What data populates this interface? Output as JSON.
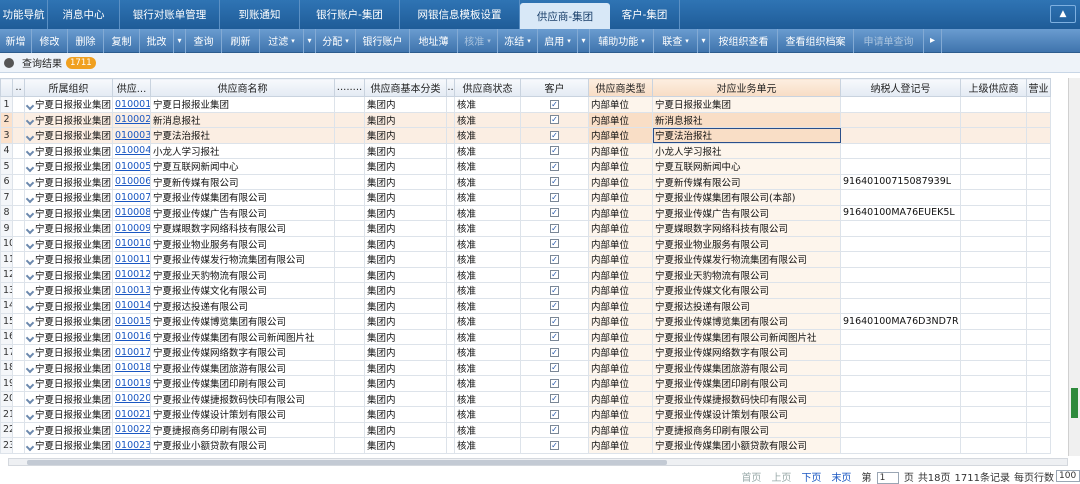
{
  "tabs": [
    {
      "label": "功能导航",
      "active": false,
      "w": 48
    },
    {
      "label": "消息中心",
      "active": false,
      "w": 72
    },
    {
      "label": "银行对账单管理",
      "active": false,
      "w": 100
    },
    {
      "label": "到账通知",
      "active": false,
      "w": 80
    },
    {
      "label": "银行账户-集团",
      "active": false,
      "w": 100
    },
    {
      "label": "网银信息模板设置",
      "active": false,
      "w": 120
    },
    {
      "label": "供应商-集团",
      "active": true,
      "w": 90
    },
    {
      "label": "客户-集团",
      "active": false,
      "w": 70
    }
  ],
  "tab_end_icon": "▲",
  "toolbar": [
    {
      "label": "新增",
      "w": 32
    },
    {
      "label": "修改",
      "w": 36
    },
    {
      "label": "删除",
      "w": 36
    },
    {
      "label": "复制",
      "w": 36
    },
    {
      "label": "批改",
      "w": 34
    },
    {
      "sep": true
    },
    {
      "label": "查询",
      "w": 36
    },
    {
      "label": "刷新",
      "w": 38
    },
    {
      "label": "过滤",
      "caret": true,
      "w": 44
    },
    {
      "sep": true
    },
    {
      "label": "分配",
      "caret": true,
      "w": 40
    },
    {
      "label": "银行账户",
      "w": 54
    },
    {
      "label": "地址薄",
      "w": 48
    },
    {
      "label": "核准",
      "caret": true,
      "disabled": true,
      "w": 40
    },
    {
      "label": "冻结",
      "caret": true,
      "w": 40
    },
    {
      "label": "启用",
      "caret": true,
      "w": 40
    },
    {
      "sep": true
    },
    {
      "label": "辅助功能",
      "caret": true,
      "w": 64
    },
    {
      "label": "联查",
      "caret": true,
      "w": 44
    },
    {
      "sep": true
    },
    {
      "label": "按组织查看",
      "w": 68
    },
    {
      "label": "查看组织档案",
      "w": 76
    },
    {
      "label": "申请单查询",
      "disabled": true,
      "w": 70
    },
    {
      "label": "▸",
      "w": 18
    }
  ],
  "result": {
    "label": "查询结果",
    "count": "1711"
  },
  "columns": [
    {
      "label": "",
      "w": 12
    },
    {
      "label": "..",
      "w": 12
    },
    {
      "label": "所属组织",
      "w": 88
    },
    {
      "label": "供应...",
      "w": 38
    },
    {
      "label": "供应商名称",
      "w": 184
    },
    {
      "label": "........",
      "w": 30
    },
    {
      "label": "供应商基本分类",
      "w": 82
    },
    {
      "label": "..",
      "w": 8
    },
    {
      "label": "供应商状态",
      "w": 66
    },
    {
      "label": "客户",
      "w": 68
    },
    {
      "label": "供应商类型",
      "w": 64,
      "hl": true
    },
    {
      "label": "对应业务单元",
      "w": 188,
      "hl": true
    },
    {
      "label": "纳税人登记号",
      "w": 120
    },
    {
      "label": "上级供应商",
      "w": 66
    },
    {
      "label": "营业",
      "w": 24
    }
  ],
  "rows": [
    {
      "n": "1",
      "org": "宁夏日报报业集团",
      "code": "010001",
      "name": "宁夏日报报业集团",
      "cls": "集团内",
      "status": "核准",
      "type": "内部单位",
      "unit": "宁夏日报报业集团",
      "tax": ""
    },
    {
      "n": "2",
      "org": "宁夏日报报业集团",
      "code": "010002",
      "name": "新消息报社",
      "cls": "集团内",
      "status": "核准",
      "type": "内部单位",
      "unit": "新消息报社",
      "tax": "",
      "sel": true
    },
    {
      "n": "3",
      "org": "宁夏日报报业集团",
      "code": "010003",
      "name": "宁夏法治报社",
      "cls": "集团内",
      "status": "核准",
      "type": "内部单位",
      "unit": "宁夏法治报社",
      "tax": "",
      "sel": true,
      "focus": true
    },
    {
      "n": "4",
      "org": "宁夏日报报业集团",
      "code": "010004",
      "name": "小龙人学习报社",
      "cls": "集团内",
      "status": "核准",
      "type": "内部单位",
      "unit": "小龙人学习报社",
      "tax": ""
    },
    {
      "n": "5",
      "org": "宁夏日报报业集团",
      "code": "010005",
      "name": "宁夏互联网新闻中心",
      "cls": "集团内",
      "status": "核准",
      "type": "内部单位",
      "unit": "宁夏互联网新闻中心",
      "tax": ""
    },
    {
      "n": "6",
      "org": "宁夏日报报业集团",
      "code": "010006",
      "name": "宁夏新传媒有限公司",
      "cls": "集团内",
      "status": "核准",
      "type": "内部单位",
      "unit": "宁夏新传媒有限公司",
      "tax": "91640100715087939L"
    },
    {
      "n": "7",
      "org": "宁夏日报报业集团",
      "code": "010007",
      "name": "宁夏报业传媒集团有限公司",
      "cls": "集团内",
      "status": "核准",
      "type": "内部单位",
      "unit": "宁夏报业传媒集团有限公司(本部)",
      "tax": ""
    },
    {
      "n": "8",
      "org": "宁夏日报报业集团",
      "code": "010008",
      "name": "宁夏报业传媒广告有限公司",
      "cls": "集团内",
      "status": "核准",
      "type": "内部单位",
      "unit": "宁夏报业传媒广告有限公司",
      "tax": "91640100MA76EUEK5L"
    },
    {
      "n": "9",
      "org": "宁夏日报报业集团",
      "code": "010009",
      "name": "宁夏媒眼数字网络科技有限公司",
      "cls": "集团内",
      "status": "核准",
      "type": "内部单位",
      "unit": "宁夏媒眼数字网络科技有限公司",
      "tax": ""
    },
    {
      "n": "10",
      "org": "宁夏日报报业集团",
      "code": "010010",
      "name": "宁夏报业物业服务有限公司",
      "cls": "集团内",
      "status": "核准",
      "type": "内部单位",
      "unit": "宁夏报业物业服务有限公司",
      "tax": ""
    },
    {
      "n": "11",
      "org": "宁夏日报报业集团",
      "code": "010011",
      "name": "宁夏报业传媒发行物流集团有限公司",
      "cls": "集团内",
      "status": "核准",
      "type": "内部单位",
      "unit": "宁夏报业传媒发行物流集团有限公司",
      "tax": ""
    },
    {
      "n": "12",
      "org": "宁夏日报报业集团",
      "code": "010012",
      "name": "宁夏报业天豹物流有限公司",
      "cls": "集团内",
      "status": "核准",
      "type": "内部单位",
      "unit": "宁夏报业天豹物流有限公司",
      "tax": ""
    },
    {
      "n": "13",
      "org": "宁夏日报报业集团",
      "code": "010013",
      "name": "宁夏报业传媒文化有限公司",
      "cls": "集团内",
      "status": "核准",
      "type": "内部单位",
      "unit": "宁夏报业传媒文化有限公司",
      "tax": ""
    },
    {
      "n": "14",
      "org": "宁夏日报报业集团",
      "code": "010014",
      "name": "宁夏报达投递有限公司",
      "cls": "集团内",
      "status": "核准",
      "type": "内部单位",
      "unit": "宁夏报达投递有限公司",
      "tax": ""
    },
    {
      "n": "15",
      "org": "宁夏日报报业集团",
      "code": "010015",
      "name": "宁夏报业传媒博览集团有限公司",
      "cls": "集团内",
      "status": "核准",
      "type": "内部单位",
      "unit": "宁夏报业传媒博览集团有限公司",
      "tax": "91640100MA76D3ND7R"
    },
    {
      "n": "16",
      "org": "宁夏日报报业集团",
      "code": "010016",
      "name": "宁夏报业传媒集团有限公司新闻图片社",
      "cls": "集团内",
      "status": "核准",
      "type": "内部单位",
      "unit": "宁夏报业传媒集团有限公司新闻图片社",
      "tax": ""
    },
    {
      "n": "17",
      "org": "宁夏日报报业集团",
      "code": "010017",
      "name": "宁夏报业传媒网络数字有限公司",
      "cls": "集团内",
      "status": "核准",
      "type": "内部单位",
      "unit": "宁夏报业传媒网络数字有限公司",
      "tax": ""
    },
    {
      "n": "18",
      "org": "宁夏日报报业集团",
      "code": "010018",
      "name": "宁夏报业传媒集团旅游有限公司",
      "cls": "集团内",
      "status": "核准",
      "type": "内部单位",
      "unit": "宁夏报业传媒集团旅游有限公司",
      "tax": ""
    },
    {
      "n": "19",
      "org": "宁夏日报报业集团",
      "code": "010019",
      "name": "宁夏报业传媒集团印刷有限公司",
      "cls": "集团内",
      "status": "核准",
      "type": "内部单位",
      "unit": "宁夏报业传媒集团印刷有限公司",
      "tax": ""
    },
    {
      "n": "20",
      "org": "宁夏日报报业集团",
      "code": "010020",
      "name": "宁夏报业传媒捷报数码快印有限公司",
      "cls": "集团内",
      "status": "核准",
      "type": "内部单位",
      "unit": "宁夏报业传媒捷报数码快印有限公司",
      "tax": ""
    },
    {
      "n": "21",
      "org": "宁夏日报报业集团",
      "code": "010021",
      "name": "宁夏报业传媒设计策划有限公司",
      "cls": "集团内",
      "status": "核准",
      "type": "内部单位",
      "unit": "宁夏报业传媒设计策划有限公司",
      "tax": ""
    },
    {
      "n": "22",
      "org": "宁夏日报报业集团",
      "code": "010022",
      "name": "宁夏捷报商务印刷有限公司",
      "cls": "集团内",
      "status": "核准",
      "type": "内部单位",
      "unit": "宁夏捷报商务印刷有限公司",
      "tax": ""
    },
    {
      "n": "23",
      "org": "宁夏日报报业集团",
      "code": "010023",
      "name": "宁夏报业小额贷款有限公司",
      "cls": "集团内",
      "status": "核准",
      "type": "内部单位",
      "unit": "宁夏报业传媒集团小额贷款有限公司",
      "tax": ""
    }
  ],
  "pager": {
    "first": "首页",
    "prev": "上页",
    "next": "下页",
    "last": "末页",
    "page_prefix": "第",
    "page_value": "1",
    "page_suffix": "页",
    "total_pages": "共18页",
    "total_records": "1711条记录",
    "per_page_label": "每页行数",
    "per_page_value": "100"
  },
  "colors": {
    "tabbar": "#1f5c98",
    "toolbar": "#4a7fb8",
    "selected_row": "#fbeee3",
    "highlight_col": "#f7dcc4",
    "link": "#1a57c2"
  }
}
